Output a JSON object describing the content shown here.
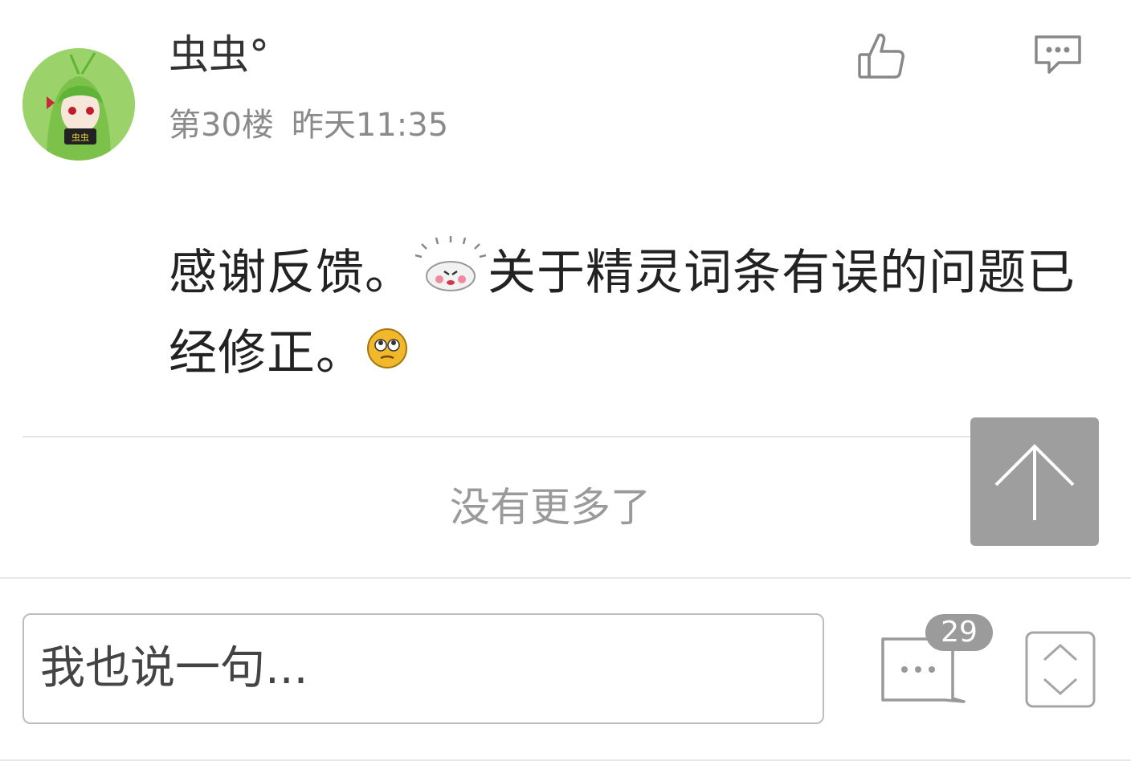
{
  "post": {
    "username": "虫虫°",
    "floor": "第30楼",
    "time": "昨天11:35",
    "content_part1": "感谢反馈。",
    "content_part2": "关于精灵词条有误的问题已经修正。",
    "icons": [
      "like-icon",
      "reply-icon",
      "surprised-emoji-icon",
      "rolling-eyes-emoji-icon"
    ]
  },
  "footer": {
    "no_more": "没有更多了"
  },
  "bottom_bar": {
    "input_placeholder": "我也说一句...",
    "comment_count": "29"
  },
  "colors": {
    "accent_gray": "#9e9e9e",
    "text_dark": "#222222",
    "text_muted": "#8a8a8a"
  }
}
